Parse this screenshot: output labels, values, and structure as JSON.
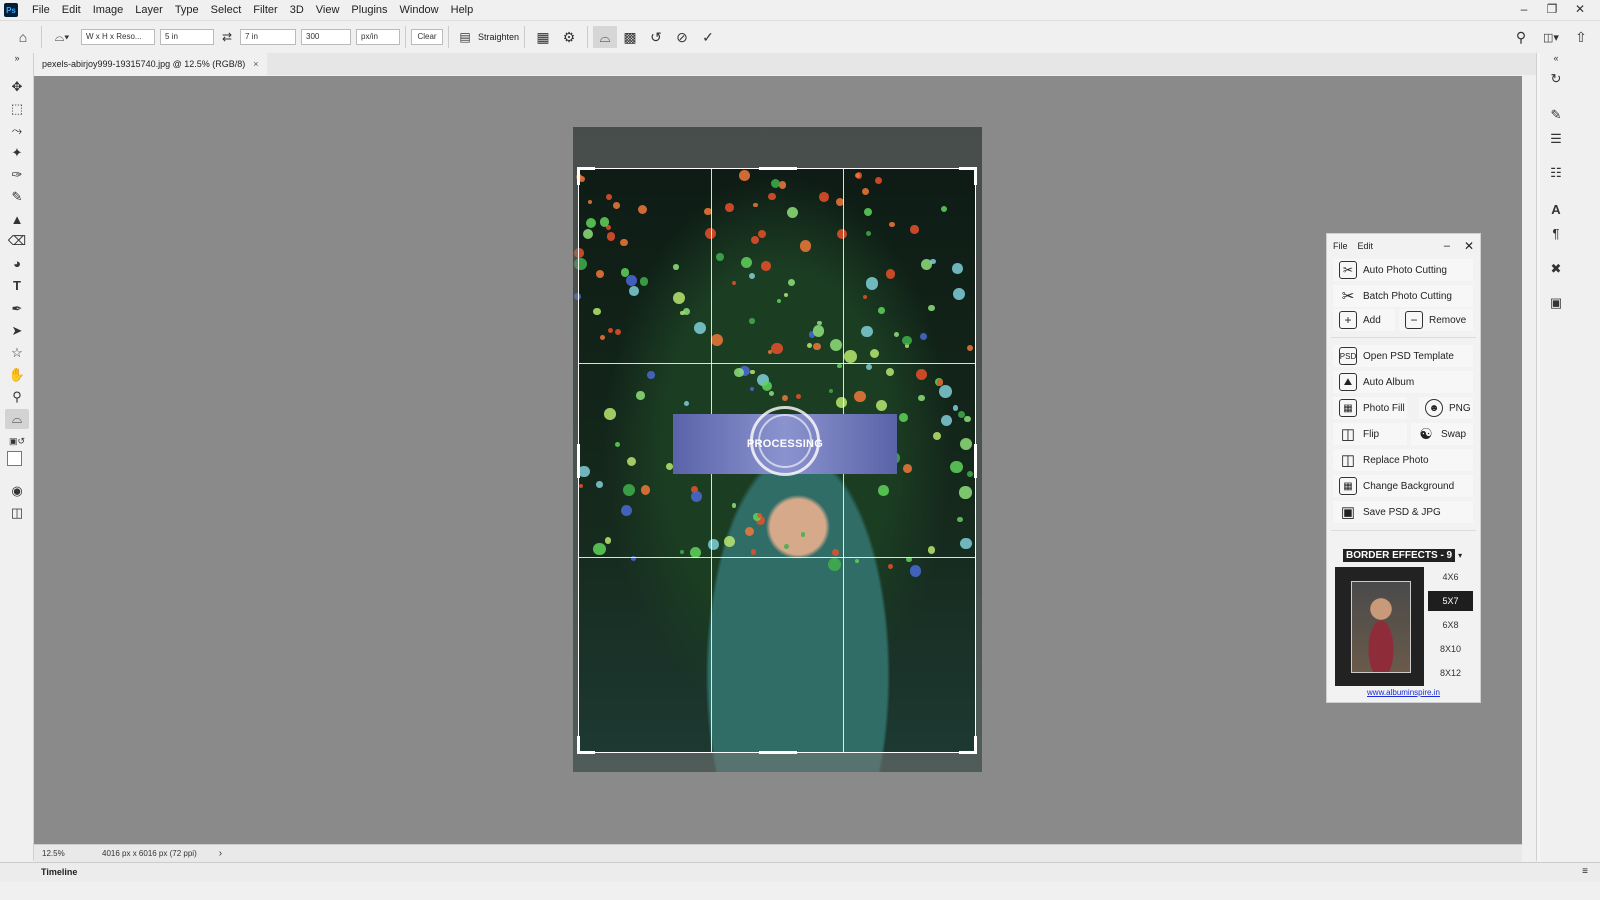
{
  "menu": {
    "items": [
      "File",
      "Edit",
      "Image",
      "Layer",
      "Type",
      "Select",
      "Filter",
      "3D",
      "View",
      "Plugins",
      "Window",
      "Help"
    ]
  },
  "options": {
    "ratio_preset": "W x H x Reso...",
    "width": "5 in",
    "height": "7 in",
    "resolution": "300",
    "unit": "px/in",
    "clear_label": "Clear",
    "straighten_label": "Straighten"
  },
  "document": {
    "tab_title": "pexels-abirjoy999-19315740.jpg @ 12.5% (RGB/8)",
    "processing_text": "PROCESSING"
  },
  "status": {
    "zoom": "12.5%",
    "doc_info": "4016 px x 6016 px (72 ppi)"
  },
  "timeline": {
    "label": "Timeline"
  },
  "plugin": {
    "menu": [
      "File",
      "Edit"
    ],
    "buttons": {
      "auto_photo_cutting": "Auto Photo Cutting",
      "batch_photo_cutting": "Batch Photo Cutting",
      "add": "Add",
      "remove": "Remove",
      "open_psd_template": "Open PSD Template",
      "auto_album": "Auto Album",
      "photo_fill": "Photo Fill",
      "png": "PNG",
      "flip": "Flip",
      "swap": "Swap",
      "replace_photo": "Replace Photo",
      "change_background": "Change Background",
      "save_psd_jpg": "Save PSD & JPG"
    },
    "border_effects": "BORDER EFFECTS - 9",
    "sizes": [
      "4X6",
      "5X7",
      "6X8",
      "8X10",
      "8X12"
    ],
    "selected_size": "5X7",
    "link": "www.albuminspire.in"
  }
}
